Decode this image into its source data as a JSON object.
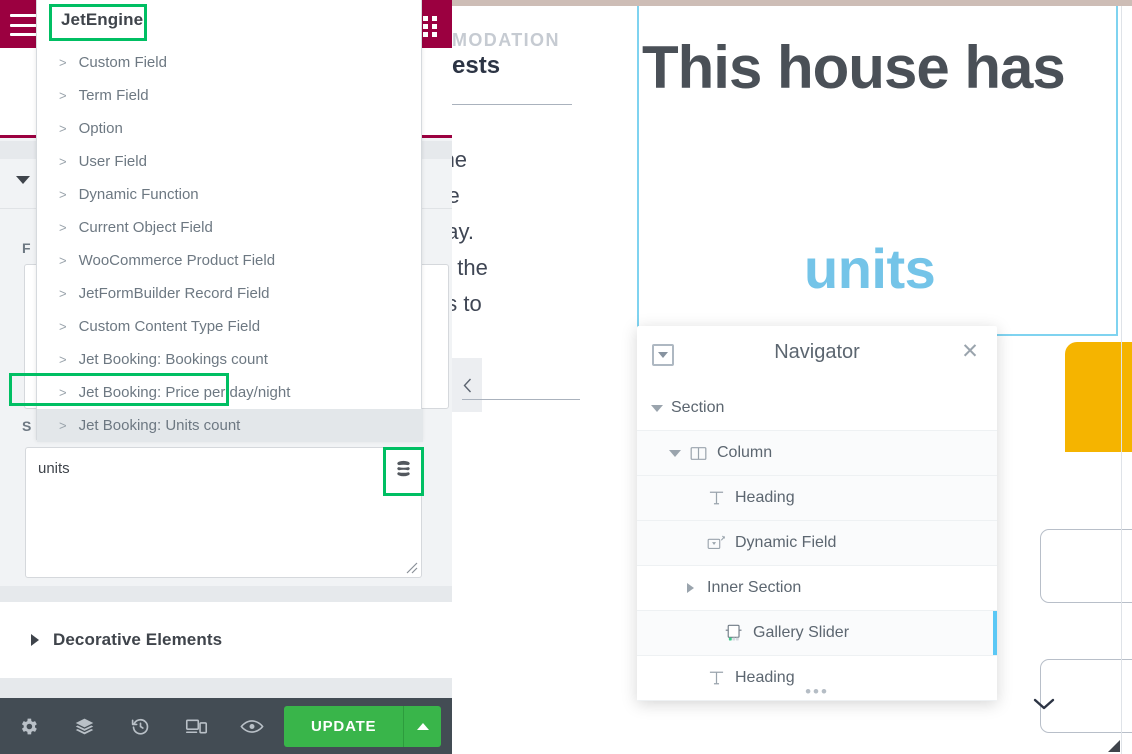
{
  "editor_panel": {
    "hamburger_icon": "hamburger-menu-icon",
    "apps_icon": "apps-grid-icon",
    "field_label": "F",
    "secondary_label": "S",
    "dynamic_tag_icon": "database-stack-icon",
    "textarea": {
      "value": "units",
      "placeholder": ""
    },
    "accordion": {
      "title": "Decorative Elements"
    },
    "bottom_bar": {
      "icons": [
        {
          "name": "settings-gear-icon",
          "label": "Settings"
        },
        {
          "name": "layers-navigator-icon",
          "label": "Navigator"
        },
        {
          "name": "history-revisions-icon",
          "label": "History"
        },
        {
          "name": "responsive-mode-icon",
          "label": "Responsive Mode"
        },
        {
          "name": "preview-eye-icon",
          "label": "Preview Changes"
        }
      ],
      "update_label": "UPDATE",
      "update_caret_icon": "caret-up-icon"
    }
  },
  "jetengine_dropdown": {
    "title": "JetEngine",
    "chevron": ">",
    "items": [
      {
        "label": "Custom Field",
        "active": false
      },
      {
        "label": "Term Field",
        "active": false
      },
      {
        "label": "Option",
        "active": false
      },
      {
        "label": "User Field",
        "active": false
      },
      {
        "label": "Dynamic Function",
        "active": false
      },
      {
        "label": "Current Object Field",
        "active": false
      },
      {
        "label": "WooCommerce Product Field",
        "active": false
      },
      {
        "label": "JetFormBuilder Record Field",
        "active": false
      },
      {
        "label": "Custom Content Type Field",
        "active": false
      },
      {
        "label": "Jet Booking: Bookings count",
        "active": false
      },
      {
        "label": "Jet Booking: Price per day/night",
        "active": false
      },
      {
        "label": "Jet Booking: Units count",
        "active": true
      }
    ]
  },
  "highlights": {
    "color": "#00bf63",
    "targets": [
      "jetengine-title",
      "jet-booking-units-count-item",
      "dynamic-tag-button"
    ]
  },
  "canvas": {
    "eyebrow": "MODATION",
    "subtitle": "ests",
    "paragraph": "of the\ns the\ntaway.\nwith the\ncess to",
    "prev_arrow_icon": "chevron-left-icon",
    "heading_main": "This house has",
    "heading_dynamic": "units",
    "required_star": "*",
    "dropdown_chevron_icon": "chevron-down-icon",
    "accent_yellow": "#f5b400",
    "accent_blue": "#74c4e8",
    "section_outline_color": "#7fd3f0"
  },
  "navigator": {
    "title": "Navigator",
    "dock_icon": "dock-collapse-icon",
    "close_icon": "close-icon",
    "resize_handle_icon": "resize-dots-icon",
    "rows": [
      {
        "label": "Section",
        "indent": 0,
        "toggle": "open",
        "icon": null,
        "active": false,
        "shade": false
      },
      {
        "label": "Column",
        "indent": 1,
        "toggle": "open",
        "icon": "column-icon",
        "active": false,
        "shade": true
      },
      {
        "label": "Heading",
        "indent": 2,
        "toggle": "none",
        "icon": "heading-text-icon",
        "active": false,
        "shade": true
      },
      {
        "label": "Dynamic Field",
        "indent": 2,
        "toggle": "none",
        "icon": "dynamic-field-icon",
        "active": false,
        "shade": true
      },
      {
        "label": "Inner Section",
        "indent": 2,
        "toggle": "closed",
        "icon": null,
        "active": false,
        "shade": false
      },
      {
        "label": "Gallery Slider",
        "indent": 3,
        "toggle": "none",
        "icon": "gallery-slider-icon",
        "active": true,
        "shade": true
      },
      {
        "label": "Heading",
        "indent": 2,
        "toggle": "none",
        "icon": "heading-text-icon",
        "active": false,
        "shade": false
      }
    ]
  }
}
